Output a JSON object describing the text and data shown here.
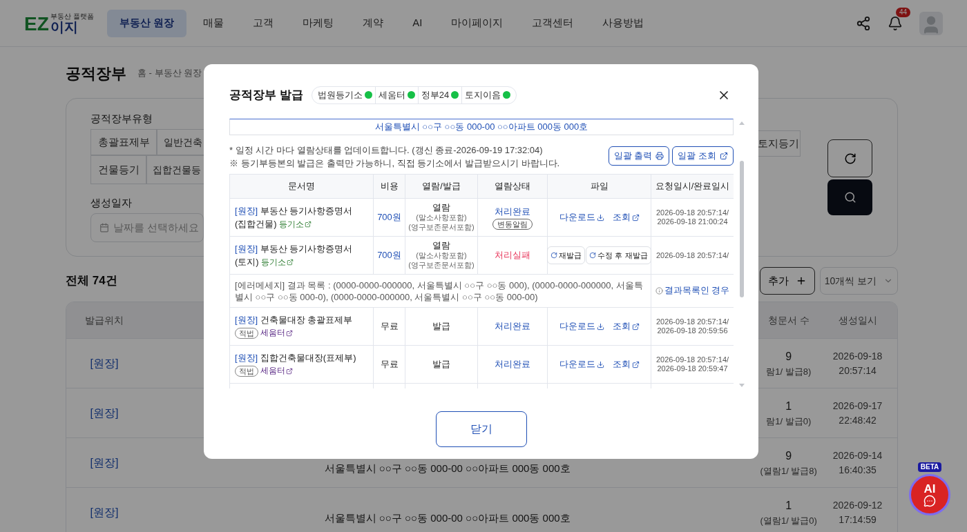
{
  "header": {
    "logo": {
      "mark": "EZ",
      "name": "이지",
      "tagline": "부동산 플랫폼"
    },
    "nav": [
      {
        "label": "부동산 원장",
        "selected": true
      },
      {
        "label": "매물",
        "selected": false
      },
      {
        "label": "고객",
        "selected": false
      },
      {
        "label": "마케팅",
        "selected": false
      },
      {
        "label": "계약",
        "selected": false
      },
      {
        "label": "AI",
        "selected": false
      },
      {
        "label": "마이페이지",
        "selected": false
      },
      {
        "label": "고객센터",
        "selected": false
      },
      {
        "label": "사용방법",
        "selected": false
      }
    ],
    "notifications": "44"
  },
  "page": {
    "title": "공적장부",
    "breadcrumb": "홈 - 부동산 원장",
    "filter": {
      "type_label": "공적장부유형",
      "types_row1": [
        "총괄표제부",
        "일반건축"
      ],
      "types_row2": [
        "건물등기",
        "집합건물등"
      ],
      "types_right": [
        "토지등기"
      ],
      "date_label": "생성일자",
      "date_placeholder": "날짜를 선택하세요"
    },
    "total": "전체 74건",
    "add_button": "추가",
    "page_size": "10개씩 보기",
    "table": {
      "columns": [
        "발급위치",
        "청문서 수",
        "생성일시"
      ],
      "rows": [
        {
          "location": "[원장]",
          "count": "9",
          "count_detail": "람1/ 발급8)",
          "date": "2026-09-18",
          "time": "20:57:14"
        },
        {
          "location": "[원장]",
          "count": "1",
          "count_detail": "람1/ 발급0)",
          "date": "2026-09-17",
          "time": "22:48:42"
        },
        {
          "location": "[원장]",
          "address": "서울특별시 ○○구 ○○동 000-00 ○○아파트 000동 000호",
          "count": "9",
          "count_detail": "(열람1/ 발급8)",
          "date": "2026-09-14",
          "time": "16:40:35"
        },
        {
          "location": "[원장]",
          "address": "서울특별시 ○○구 ○○동 000-00 ○○아파트 000동 000호",
          "count": "1",
          "count_detail": "(열람1/ 발급0)",
          "date": "2026-09-12",
          "time": "17:14:59"
        }
      ]
    }
  },
  "modal": {
    "title": "공적장부 발급",
    "services": [
      {
        "name": "법원등기소",
        "online": true
      },
      {
        "name": "세움터",
        "online": true
      },
      {
        "name": "정부24",
        "online": true
      },
      {
        "name": "토지이음",
        "online": true
      }
    ],
    "address": "서울특별시 ○○구 ○○동 000-00 ○○아파트 000동 000호",
    "notes": [
      "* 일정 시간 마다 열람상태를 업데이트합니다. (갱신 종료-2026-09-19 17:32:04)",
      "※ 등기부등본의 발급은 출력만 가능하니, 직접 등기소에서 발급받으시기 바랍니다."
    ],
    "actions": [
      "일괄 출력",
      "일괄 조회"
    ],
    "columns": [
      "문서명",
      "비용",
      "열람/발급",
      "열람상태",
      "파일",
      "요청일시/완료일시"
    ],
    "rows": [
      {
        "kind": "document",
        "tag": "[원장]",
        "title": "부동산 등기사항증명서 (집합건물)",
        "source": {
          "label": "등기소",
          "color": "#2e7d32"
        },
        "cost": "700원",
        "paid": true,
        "mode": "열람",
        "mode_notes": [
          "(말소사항포함)",
          "(영구보존문서포함)"
        ],
        "status": "처리완료",
        "failed": false,
        "status_tag": "변동알림",
        "file": {
          "kind": "links",
          "download": "다운로드",
          "view": "조회"
        },
        "times": [
          "2026-09-18 20:57:14/",
          "2026-09-18 21:00:24"
        ]
      },
      {
        "kind": "document",
        "tag": "[원장]",
        "title": "부동산 등기사항증명서(토지)",
        "source": {
          "label": "등기소",
          "color": "#2e7d32"
        },
        "cost": "700원",
        "paid": true,
        "mode": "열람",
        "mode_notes": [
          "(말소사항포함)",
          "(영구보존문서포함)"
        ],
        "status": "처리실패",
        "failed": true,
        "file": {
          "kind": "retry",
          "buttons": [
            "재발급",
            "수정 후 재발급"
          ]
        },
        "times": [
          "2026-09-18 20:57:14/"
        ]
      },
      {
        "kind": "error",
        "message": "[에러메세지] 결과 목록 : (0000-0000-000000, 서울특별시 ○○구 ○○동 000), (0000-0000-000000, 서울특별시 ○○구 ○○동 000-0), (0000-0000-000000, 서울특별시 ○○구 ○○동 000-00)",
        "help": "결과목록인 경우"
      },
      {
        "kind": "document",
        "tag": "[원장]",
        "title": "건축물대장 총괄표제부",
        "badge": "적법",
        "source": {
          "label": "세움터",
          "color": "#5b2a86"
        },
        "cost": "무료",
        "paid": false,
        "mode": "발급",
        "status": "처리완료",
        "failed": false,
        "file": {
          "kind": "links",
          "download": "다운로드",
          "view": "조회"
        },
        "times": [
          "2026-09-18 20:57:14/",
          "2026-09-18 20:59:56"
        ]
      },
      {
        "kind": "document",
        "tag": "[원장]",
        "title": "집합건축물대장(표제부)",
        "badge": "적법",
        "source": {
          "label": "세움터",
          "color": "#5b2a86"
        },
        "cost": "무료",
        "paid": false,
        "mode": "발급",
        "status": "처리완료",
        "failed": false,
        "file": {
          "kind": "links",
          "download": "다운로드",
          "view": "조회"
        },
        "times": [
          "2026-09-18 20:57:14/",
          "2026-09-18 20:59:47"
        ]
      }
    ],
    "close": "닫기"
  },
  "ai_button": {
    "badge": "BETA",
    "label": "AI"
  }
}
